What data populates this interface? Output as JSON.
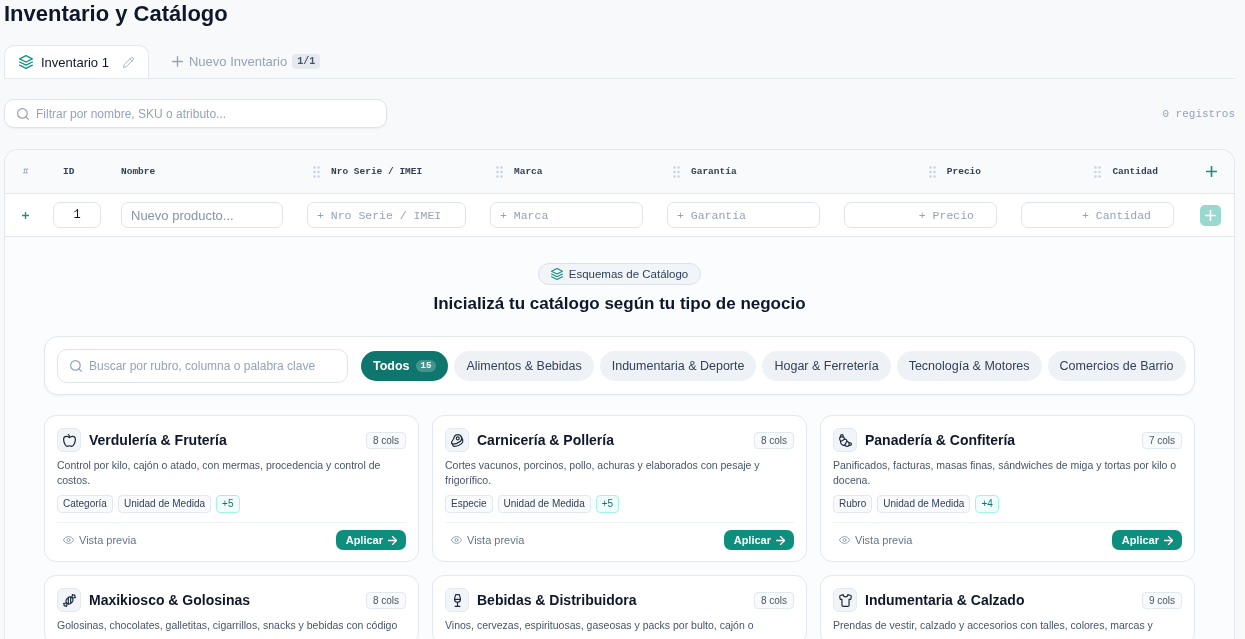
{
  "page": {
    "title": "Inventario y Catálogo"
  },
  "tabs": [
    {
      "label": "Inventario 1",
      "selected": true
    }
  ],
  "new_tab_button": {
    "label": "Nuevo Inventario",
    "badge": "1/1"
  },
  "filter": {
    "placeholder": "Filtrar por nombre, SKU o atributo...",
    "record_count": "0 registros"
  },
  "table": {
    "columns": [
      {
        "label": "#",
        "kind": "index"
      },
      {
        "label": "ID",
        "kind": "id"
      },
      {
        "label": "Nombre",
        "kind": "name"
      },
      {
        "label": "Nro Serie / IMEI",
        "kind": "text"
      },
      {
        "label": "Marca",
        "kind": "text"
      },
      {
        "label": "Garantía",
        "kind": "text"
      },
      {
        "label": "Precio",
        "kind": "number"
      },
      {
        "label": "Cantidad",
        "kind": "number"
      }
    ],
    "new_row": {
      "id": "1",
      "cells": [
        {
          "placeholder": "Nuevo producto..."
        },
        {
          "placeholder": "+ Nro Serie / IMEI"
        },
        {
          "placeholder": "+ Marca"
        },
        {
          "placeholder": "+ Garantía"
        },
        {
          "placeholder": "+ Precio"
        },
        {
          "placeholder": "+ Cantidad"
        }
      ]
    }
  },
  "schemas": {
    "badge": "Esquemas de Catálogo",
    "heading": "Inicializá tu catálogo según tu tipo de negocio",
    "search": {
      "placeholder": "Buscar por rubro, columna o palabra clave"
    },
    "filters": [
      {
        "label": "Todos",
        "count": "15",
        "selected": true
      },
      {
        "label": "Alimentos & Bebidas",
        "selected": false
      },
      {
        "label": "Indumentaria & Deporte",
        "selected": false
      },
      {
        "label": "Hogar & Ferretería",
        "selected": false
      },
      {
        "label": "Tecnología & Motores",
        "selected": false
      },
      {
        "label": "Comercios de Barrio",
        "selected": false
      }
    ],
    "cards": [
      {
        "kind": "produce",
        "title": "Verdulería & Frutería",
        "cols": "8 cols",
        "description": "Control por kilo, cajón o atado, con mermas, procedencia y control de costos.",
        "tags": [
          {
            "label": "Categoría",
            "kind": "field"
          },
          {
            "label": "Unidad de Medida",
            "kind": "field"
          },
          {
            "label": "+5",
            "kind": "more"
          }
        ],
        "preview_label": "Vista previa",
        "apply_label": "Aplicar"
      },
      {
        "kind": "meat",
        "title": "Carnicería & Pollería",
        "cols": "8 cols",
        "description": "Cortes vacunos, porcinos, pollo, achuras y elaborados con pesaje y frigorífico.",
        "tags": [
          {
            "label": "Especie",
            "kind": "field"
          },
          {
            "label": "Unidad de Medida",
            "kind": "field"
          },
          {
            "label": "+5",
            "kind": "more"
          }
        ],
        "preview_label": "Vista previa",
        "apply_label": "Aplicar"
      },
      {
        "kind": "bakery",
        "title": "Panadería & Confitería",
        "cols": "7 cols",
        "description": "Panificados, facturas, masas finas, sándwiches de miga y tortas por kilo o docena.",
        "tags": [
          {
            "label": "Rubro",
            "kind": "field"
          },
          {
            "label": "Unidad de Medida",
            "kind": "field"
          },
          {
            "label": "+4",
            "kind": "more"
          }
        ],
        "preview_label": "Vista previa",
        "apply_label": "Aplicar"
      },
      {
        "kind": "candy",
        "title": "Maxikiosco & Golosinas",
        "cols": "8 cols",
        "description": "Golosinas, chocolates, galletitas, cigarrillos, snacks y bebidas con código"
      },
      {
        "kind": "drinks",
        "title": "Bebidas & Distribuidora",
        "cols": "8 cols",
        "description": "Vinos, cervezas, espirituosas, gaseosas y packs por bulto, cajón o"
      },
      {
        "kind": "clothing",
        "title": "Indumentaria & Calzado",
        "cols": "9 cols",
        "description": "Prendas de vestir, calzado y accesorios con talles, colores, marcas y"
      }
    ]
  }
}
